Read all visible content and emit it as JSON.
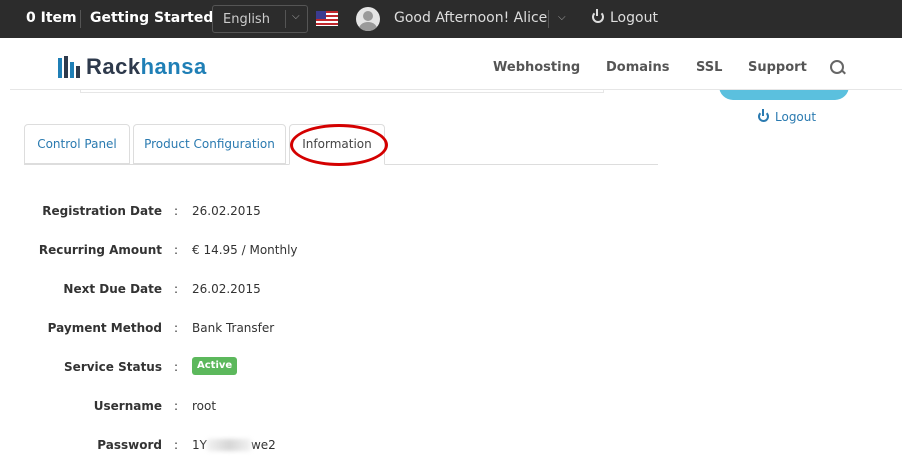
{
  "topbar": {
    "cart": "0 Item",
    "getting_started": "Getting Started",
    "language": "English",
    "greeting": "Good Afternoon! Alice",
    "logout": "Logout"
  },
  "header": {
    "logo_part1": "Rack",
    "logo_part2": "hansa",
    "nav": [
      "Webhosting",
      "Domains",
      "SSL",
      "Support"
    ]
  },
  "sidebar": {
    "logout": "Logout"
  },
  "tabs": [
    "Control Panel",
    "Product Configuration",
    "Information"
  ],
  "info": {
    "rows": [
      {
        "label": "Registration Date",
        "colon": ":",
        "value": "26.02.2015"
      },
      {
        "label": "Recurring Amount",
        "colon": ":",
        "value": "€ 14.95 / Monthly"
      },
      {
        "label": "Next Due Date",
        "colon": ":",
        "value": "26.02.2015"
      },
      {
        "label": "Payment Method",
        "colon": ":",
        "value": "Bank Transfer"
      },
      {
        "label": "Service Status",
        "colon": ":",
        "value": "Active"
      },
      {
        "label": "Username",
        "colon": ":",
        "value": "root"
      },
      {
        "label": "Password",
        "colon": ":",
        "value_start": "1Y",
        "value_end": "we2"
      }
    ]
  },
  "colors": {
    "topbar_bg": "#2c2c2c",
    "link": "#2a7ab0",
    "active_badge": "#5cb85c",
    "highlight_ellipse": "#d40000",
    "button_teal": "#5bc0de"
  }
}
